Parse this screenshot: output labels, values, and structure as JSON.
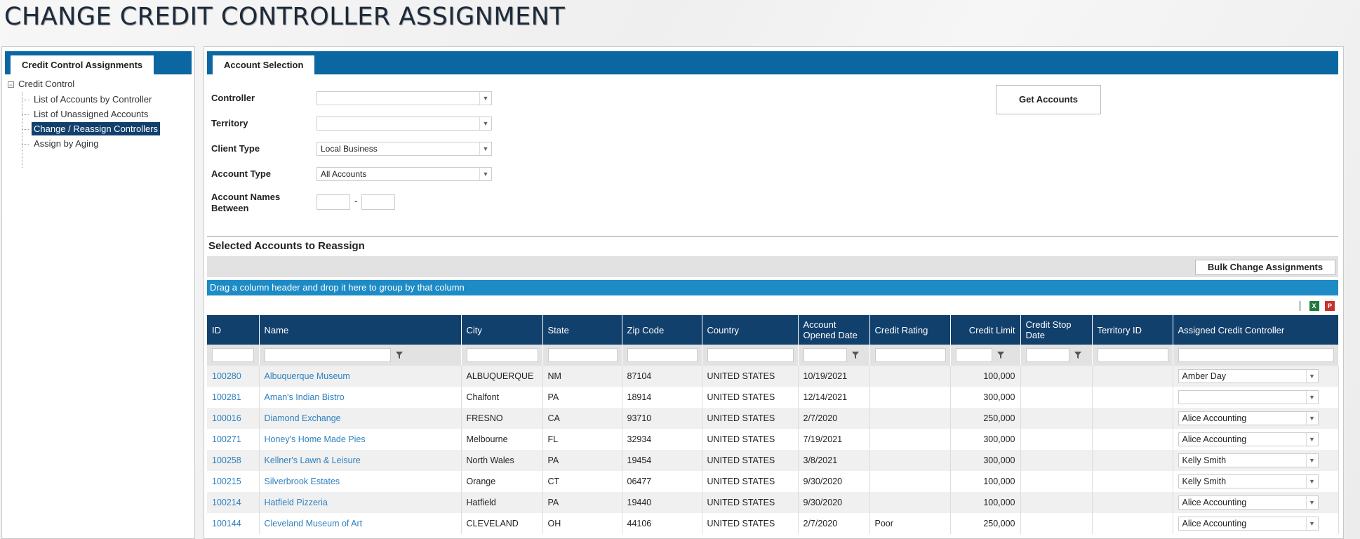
{
  "page": {
    "title": "CHANGE CREDIT CONTROLLER ASSIGNMENT"
  },
  "left_panel": {
    "tab_label": "Credit Control Assignments",
    "tree": {
      "root_label": "Credit Control",
      "root_toggle": "−",
      "items": [
        {
          "label": "List of Accounts by Controller",
          "active": false
        },
        {
          "label": "List of Unassigned Accounts",
          "active": false
        },
        {
          "label": "Change / Reassign Controllers",
          "active": true
        },
        {
          "label": "Assign by Aging",
          "active": false
        }
      ]
    }
  },
  "right_panel": {
    "tab_label": "Account Selection",
    "form": {
      "controller_label": "Controller",
      "controller_value": "",
      "territory_label": "Territory",
      "territory_value": "",
      "client_type_label": "Client Type",
      "client_type_value": "Local Business",
      "account_type_label": "Account Type",
      "account_type_value": "All Accounts",
      "account_names_label_1": "Account Names",
      "account_names_label_2": "Between",
      "range_separator": "-",
      "get_accounts_label": "Get Accounts"
    },
    "section_title": "Selected Accounts to Reassign",
    "bulk_change_label": "Bulk Change Assignments",
    "group_hint": "Drag a column header and drop it here to group by that column",
    "grid": {
      "columns": {
        "id": "ID",
        "name": "Name",
        "city": "City",
        "state": "State",
        "zip": "Zip Code",
        "country": "Country",
        "opened": "Account Opened Date",
        "rating": "Credit Rating",
        "limit": "Credit Limit",
        "stop": "Credit Stop Date",
        "territory": "Territory ID",
        "controller": "Assigned Credit Controller"
      },
      "rows": [
        {
          "id": "100280",
          "name": "Albuquerque Museum",
          "city": "ALBUQUERQUE",
          "state": "NM",
          "zip": "87104",
          "country": "UNITED STATES",
          "opened": "10/19/2021",
          "rating": "",
          "limit": "100,000",
          "stop": "",
          "territory": "",
          "controller": "Amber Day"
        },
        {
          "id": "100281",
          "name": "Aman's Indian Bistro",
          "city": "Chalfont",
          "state": "PA",
          "zip": "18914",
          "country": "UNITED STATES",
          "opened": "12/14/2021",
          "rating": "",
          "limit": "300,000",
          "stop": "",
          "territory": "",
          "controller": ""
        },
        {
          "id": "100016",
          "name": "Diamond Exchange",
          "city": "FRESNO",
          "state": "CA",
          "zip": "93710",
          "country": "UNITED STATES",
          "opened": "2/7/2020",
          "rating": "",
          "limit": "250,000",
          "stop": "",
          "territory": "",
          "controller": "Alice Accounting"
        },
        {
          "id": "100271",
          "name": "Honey's Home Made Pies",
          "city": "Melbourne",
          "state": "FL",
          "zip": "32934",
          "country": "UNITED STATES",
          "opened": "7/19/2021",
          "rating": "",
          "limit": "300,000",
          "stop": "",
          "territory": "",
          "controller": "Alice Accounting"
        },
        {
          "id": "100258",
          "name": "Kellner's Lawn & Leisure",
          "city": "North Wales",
          "state": "PA",
          "zip": "19454",
          "country": "UNITED STATES",
          "opened": "3/8/2021",
          "rating": "",
          "limit": "300,000",
          "stop": "",
          "territory": "",
          "controller": "Kelly Smith"
        },
        {
          "id": "100215",
          "name": "Silverbrook Estates",
          "city": "Orange",
          "state": "CT",
          "zip": "06477",
          "country": "UNITED STATES",
          "opened": "9/30/2020",
          "rating": "",
          "limit": "100,000",
          "stop": "",
          "territory": "",
          "controller": "Kelly Smith"
        },
        {
          "id": "100214",
          "name": "Hatfield Pizzeria",
          "city": "Hatfield",
          "state": "PA",
          "zip": "19440",
          "country": "UNITED STATES",
          "opened": "9/30/2020",
          "rating": "",
          "limit": "100,000",
          "stop": "",
          "territory": "",
          "controller": "Alice Accounting"
        },
        {
          "id": "100144",
          "name": "Cleveland Museum of Art",
          "city": "CLEVELAND",
          "state": "OH",
          "zip": "44106",
          "country": "UNITED STATES",
          "opened": "2/7/2020",
          "rating": "Poor",
          "limit": "250,000",
          "stop": "",
          "territory": "",
          "controller": "Alice Accounting"
        }
      ]
    }
  },
  "icons": {
    "dropdown_arrow": "▼",
    "excel": "excel-export-icon",
    "pdf": "pdf-export-icon",
    "filter": "filter-icon"
  },
  "colors": {
    "header_navy": "#12406d",
    "tab_blue": "#0a67a1",
    "group_bar": "#1d8bc6",
    "link": "#2e80bf"
  }
}
